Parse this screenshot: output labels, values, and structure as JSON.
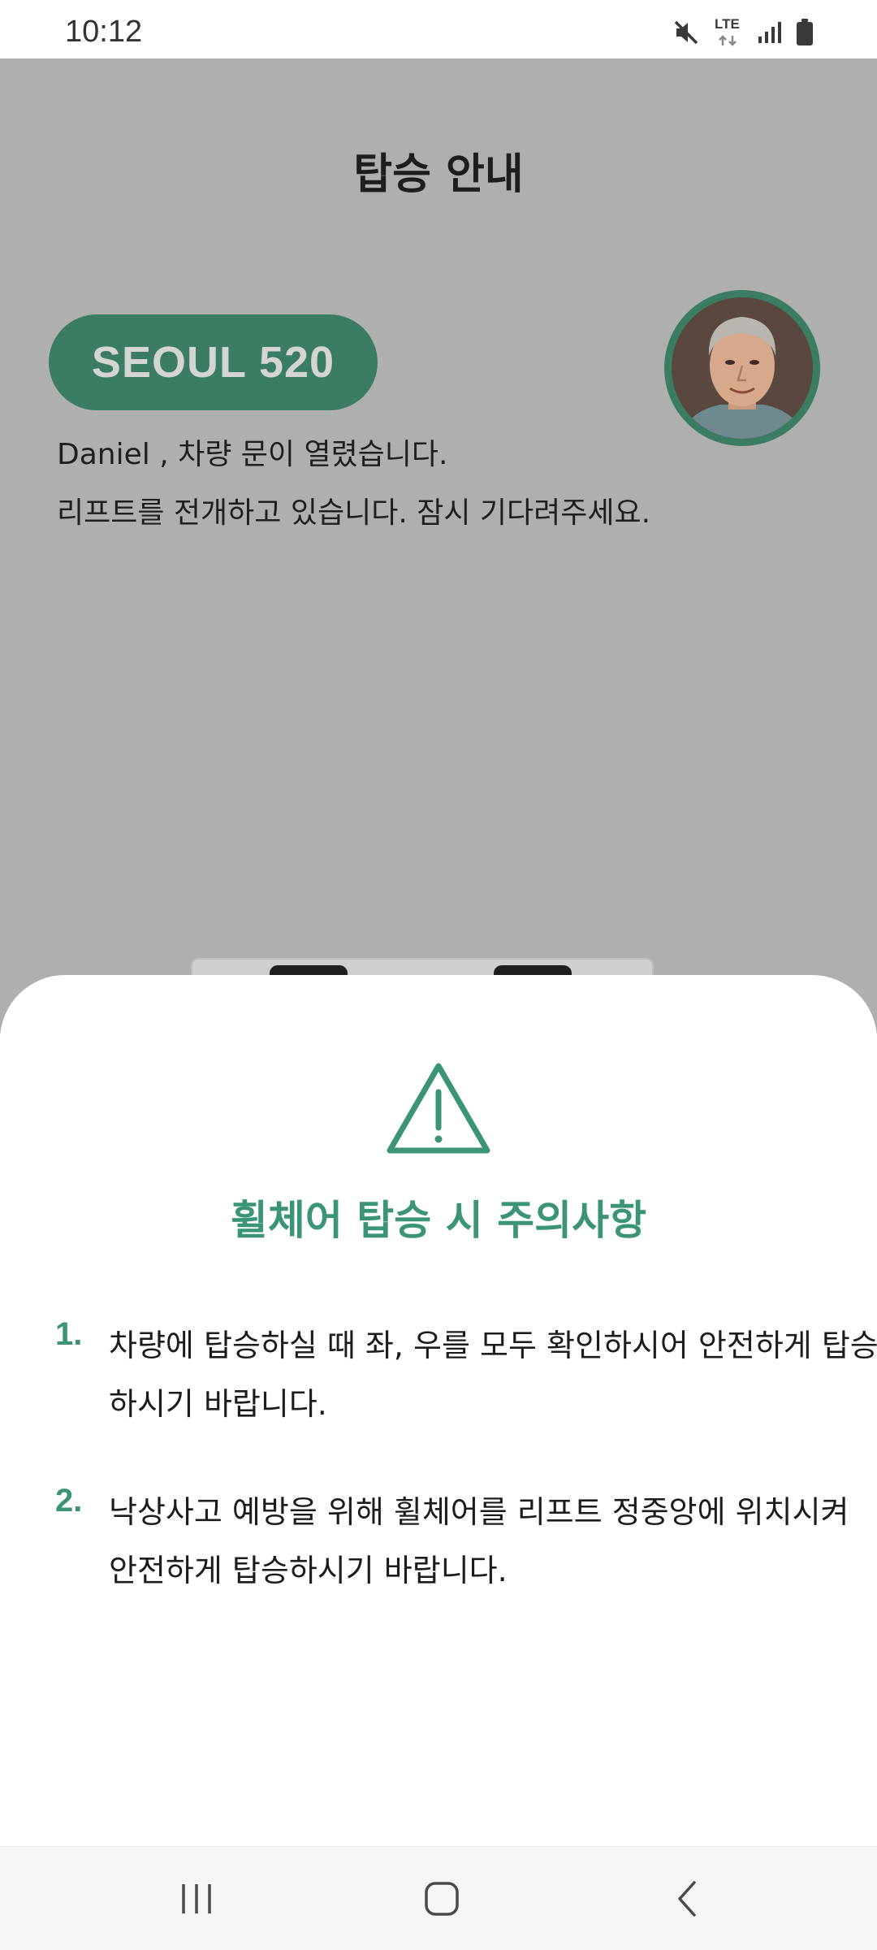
{
  "status_bar": {
    "time": "10:12",
    "network_label": "LTE",
    "icons": [
      "mute-icon",
      "lte-data-icon",
      "signal-icon",
      "battery-icon"
    ]
  },
  "screen": {
    "title": "탑승 안내",
    "vehicle_id": "SEOUL 520",
    "door_message": "Daniel , 차량 문이 열렸습니다.",
    "lift_message": "리프트를 전개하고 있습니다. 잠시 기다려주세요."
  },
  "sheet": {
    "icon": "warning-triangle-icon",
    "title": "휠체어 탑승 시 주의사항",
    "notices": [
      {
        "number": "1.",
        "text": "차량에 탑승하실 때 좌, 우를 모두 확인하시어 안전하게 탑승하시기 바랍니다."
      },
      {
        "number": "2.",
        "text": "낙상사고 예방을 위해 휠체어를 리프트 정중앙에 위치시켜 안전하게 탑승하시기 바랍니다."
      }
    ]
  },
  "colors": {
    "accent": "#3c9478",
    "badge": "#3a7d63",
    "dim_overlay": "#afafaf"
  },
  "nav_bar": {
    "icons": [
      "recent-apps-icon",
      "home-icon",
      "back-icon"
    ]
  }
}
